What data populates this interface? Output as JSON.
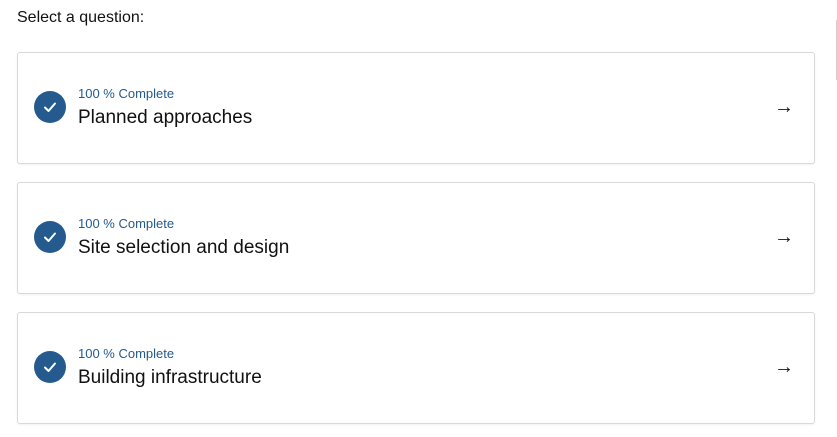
{
  "prompt": "Select a question:",
  "questions": [
    {
      "status": "100 % Complete",
      "title": "Planned approaches",
      "arrow": "→"
    },
    {
      "status": "100 % Complete",
      "title": "Site selection and design",
      "arrow": "→"
    },
    {
      "status": "100 % Complete",
      "title": "Building infrastructure",
      "arrow": "→"
    }
  ],
  "colors": {
    "accent": "#255a8f",
    "border": "#d9d9d9",
    "text": "#111111"
  },
  "icons": {
    "complete": "check-circle-icon",
    "go": "arrow-right-icon"
  }
}
